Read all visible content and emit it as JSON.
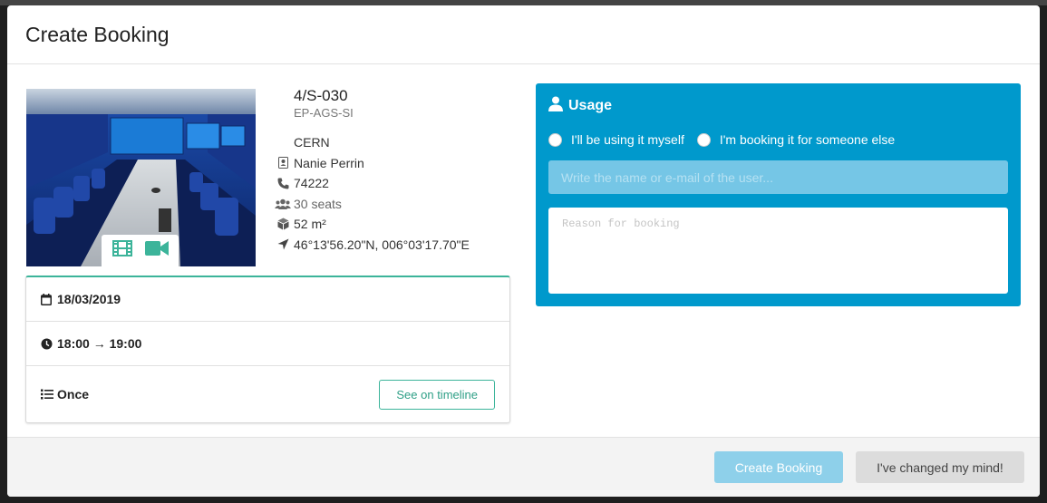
{
  "modal": {
    "title": "Create Booking"
  },
  "room": {
    "name": "4/S-030",
    "division": "EP-AGS-SI",
    "site": "CERN",
    "owner": "Nanie Perrin",
    "phone": "74222",
    "seats": "30 seats",
    "area": "52 m²",
    "coordinates": "46°13'56.20\"N, 006°03'17.70\"E",
    "photo_icons": [
      "film-icon",
      "video-camera-icon"
    ]
  },
  "booking": {
    "date": "18/03/2019",
    "time": "18:00 → 19:00",
    "recurrence": "Once",
    "timeline_button": "See on timeline"
  },
  "usage": {
    "title": "Usage",
    "options": [
      "I'll be using it myself",
      "I'm booking it for someone else"
    ],
    "user_placeholder": "Write the name or e-mail of the user...",
    "reason_placeholder": "Reason for booking"
  },
  "footer": {
    "create_label": "Create Booking",
    "cancel_label": "I've changed my mind!"
  },
  "colors": {
    "accent": "#3cb49a",
    "usage_bg": "#0099cc"
  }
}
